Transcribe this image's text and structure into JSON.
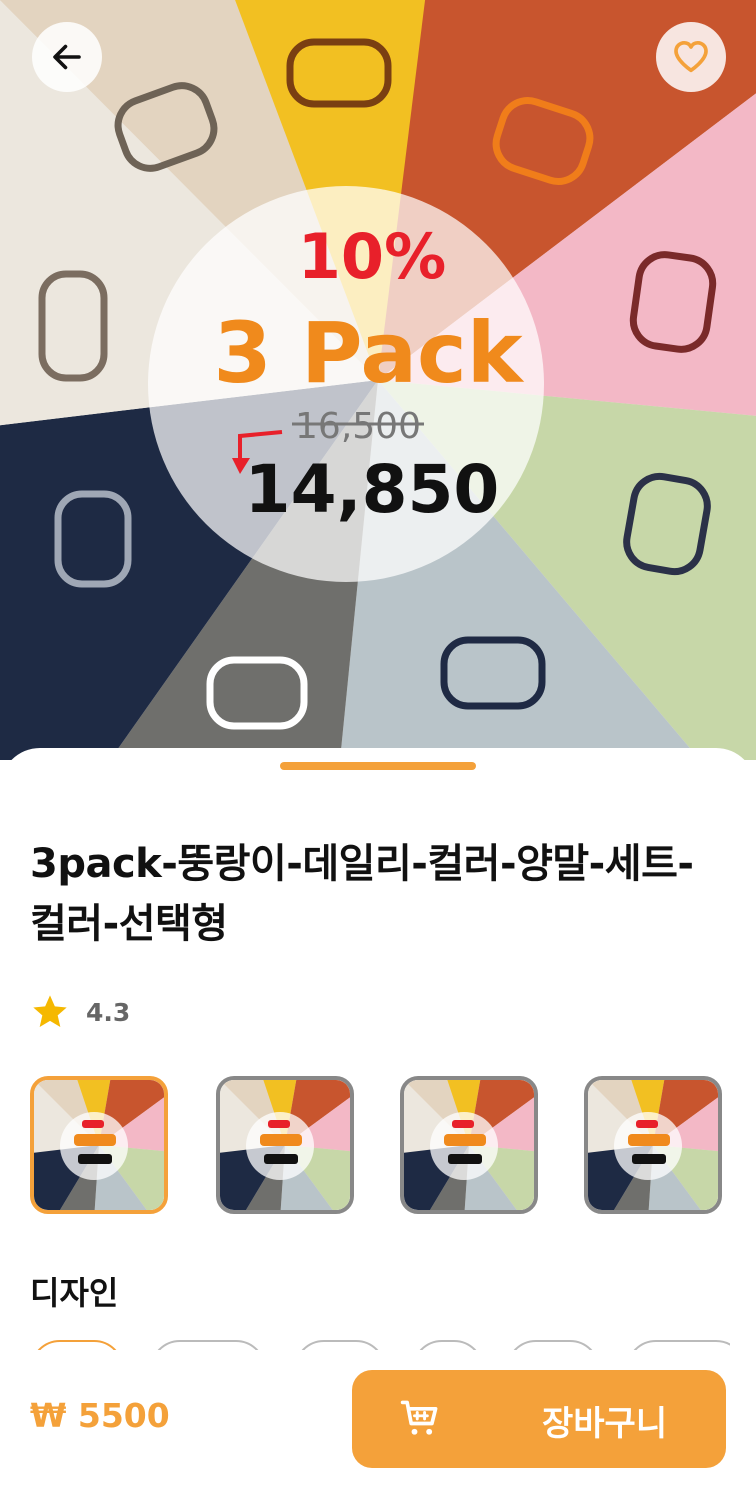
{
  "hero": {
    "badge_percent": "10%",
    "badge_pack": "3 Pack",
    "badge_old_price": "16,500",
    "badge_new_price": "14,850"
  },
  "product": {
    "title": "3pack-뚱랑이-데일리-컬러-양말-세트-컬러-선택형",
    "rating": "4.3",
    "rating_max": 5
  },
  "design_section": {
    "title": "디자인"
  },
  "bottom_bar": {
    "price": "₩ 5500",
    "cart_button_label": "장바구니"
  },
  "colors": {
    "accent": "#f4a13a",
    "star": "#f5b800",
    "badge_red": "#e8202a",
    "badge_orange": "#f08a1c"
  },
  "icons": [
    "arrow-left-icon",
    "heart-outline-icon",
    "star-icon",
    "cart-icon"
  ]
}
